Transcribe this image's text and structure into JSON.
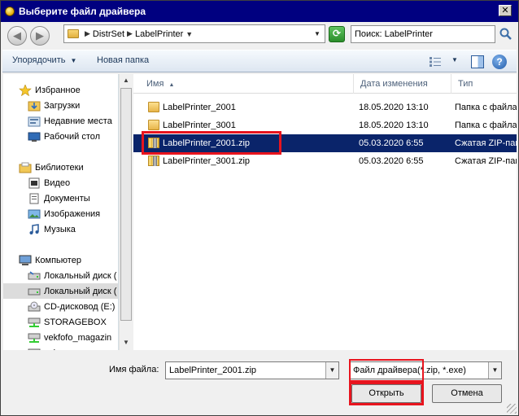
{
  "window": {
    "title": "Выберите файл драйвера",
    "close_glyph": "✕"
  },
  "address": {
    "back_glyph": "◀",
    "forward_glyph": "▶",
    "crumbs": [
      "DistrSet",
      "LabelPrinter"
    ],
    "search_placeholder": "Поиск: LabelPrinter"
  },
  "toolbar": {
    "organize_label": "Упорядочить",
    "new_folder_label": "Новая папка",
    "help_glyph": "?"
  },
  "sidebar": {
    "items": [
      {
        "label": "Избранное",
        "icon": "star-icon"
      },
      {
        "label": "Загрузки",
        "icon": "downloads-icon"
      },
      {
        "label": "Недавние места",
        "icon": "recent-places-icon"
      },
      {
        "label": "Рабочий стол",
        "icon": "desktop-icon"
      },
      {
        "label": "Библиотеки",
        "icon": "libraries-icon"
      },
      {
        "label": "Видео",
        "icon": "video-icon"
      },
      {
        "label": "Документы",
        "icon": "documents-icon"
      },
      {
        "label": "Изображения",
        "icon": "pictures-icon"
      },
      {
        "label": "Музыка",
        "icon": "music-icon"
      },
      {
        "label": "Компьютер",
        "icon": "computer-icon"
      },
      {
        "label": "Локальный диск (",
        "icon": "local-disk-icon"
      },
      {
        "label": "Локальный диск (",
        "icon": "local-disk-icon"
      },
      {
        "label": "CD-дисковод (E:)",
        "icon": "cd-drive-icon"
      },
      {
        "label": "STORAGEBOX",
        "icon": "network-drive-icon"
      },
      {
        "label": "vekfofo_magazin",
        "icon": "network-drive-icon"
      },
      {
        "label": "vekcaza",
        "icon": "network-drive-icon"
      }
    ]
  },
  "filelist": {
    "columns": [
      "Имя",
      "Дата изменения",
      "Тип"
    ],
    "rows": [
      {
        "name": "LabelPrinter_2001",
        "date": "18.05.2020 13:10",
        "type": "Папка с файлами",
        "kind": "folder"
      },
      {
        "name": "LabelPrinter_3001",
        "date": "18.05.2020 13:10",
        "type": "Папка с файлами",
        "kind": "folder"
      },
      {
        "name": "LabelPrinter_2001.zip",
        "date": "05.03.2020 6:55",
        "type": "Сжатая ZIP-папка",
        "kind": "zip",
        "selected": true
      },
      {
        "name": "LabelPrinter_3001.zip",
        "date": "05.03.2020 6:55",
        "type": "Сжатая ZIP-папка",
        "kind": "zip"
      }
    ]
  },
  "bottom": {
    "filename_label": "Имя файла:",
    "filename_value": "LabelPrinter_2001.zip",
    "filter_value": "Файл драйвера(*.zip, *.exe)",
    "open_label": "Открыть",
    "cancel_label": "Отмена"
  },
  "colors": {
    "selection": "#0a246a",
    "highlight": "#e8141e",
    "title_bar": "#000080"
  }
}
